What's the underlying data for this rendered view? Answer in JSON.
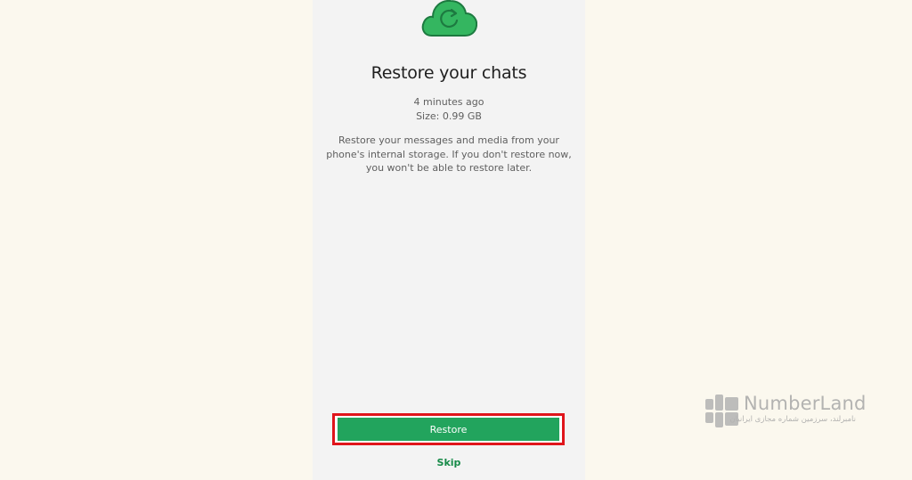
{
  "screen": {
    "title": "Restore your chats",
    "backup_time": "4 minutes ago",
    "backup_size": "Size: 0.99 GB",
    "description_lines": [
      "Restore your messages and media from your",
      "phone's internal storage. If you don't restore now,",
      "you won't be able to restore later."
    ],
    "icon": "cloud-restore-icon"
  },
  "actions": {
    "restore_label": "Restore",
    "skip_label": "Skip"
  },
  "watermark": {
    "brand": "NumberLand",
    "tagline": "نامبرلند، سرزمین شماره مجازی ایرانیان"
  },
  "colors": {
    "accent": "#22a45d",
    "highlight": "#e0151b",
    "background": "#fbf8ee",
    "phone_background": "#f3f3f3"
  }
}
